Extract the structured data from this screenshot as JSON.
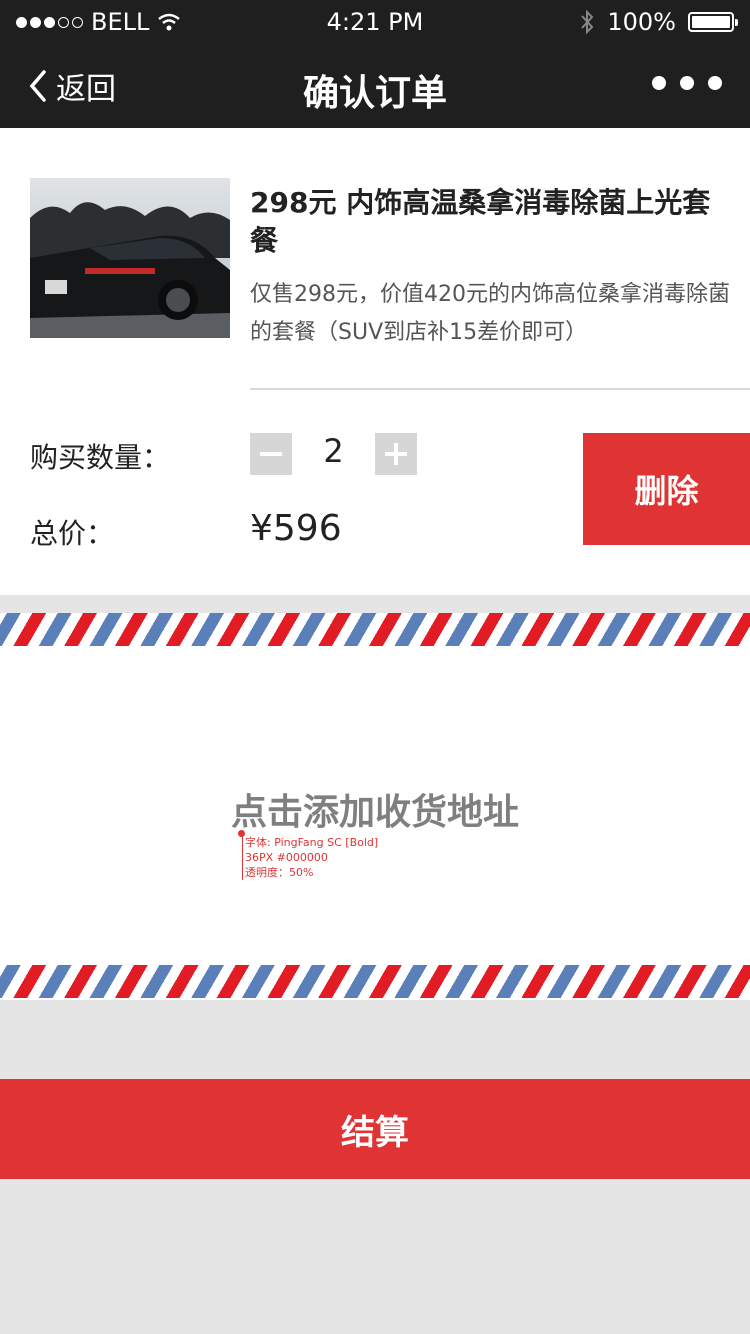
{
  "status_bar": {
    "carrier": "BELL",
    "time": "4:21 PM",
    "battery": "100%"
  },
  "nav": {
    "back_label": "返回",
    "title": "确认订单"
  },
  "product": {
    "title": "298元 内饰高温桑拿消毒除菌上光套餐",
    "description": "仅售298元，价值420元的内饰高位桑拿消毒除菌的套餐（SUV到店补15差价即可）"
  },
  "quantity": {
    "label": "购买数量：",
    "value": "2"
  },
  "total": {
    "label": "总价：",
    "value": "¥596"
  },
  "delete_label": "删除",
  "address": {
    "placeholder": "点击添加收货地址",
    "annotation": {
      "line1": "字体: PingFang SC [Bold]",
      "line2": "36PX #000000",
      "line3": "透明度：50%"
    }
  },
  "checkout_label": "结算",
  "colors": {
    "nav_background": "#1f1f1f",
    "accent_red": "#e03434",
    "airmail_red": "#e21c24",
    "airmail_blue": "#5b7fb8",
    "page_background": "#e5e5e5"
  }
}
